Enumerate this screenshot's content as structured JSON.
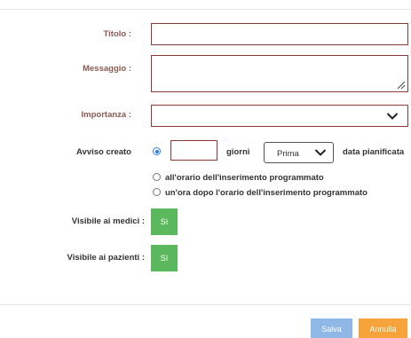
{
  "form": {
    "title_label": "Titolo :",
    "title_value": "",
    "message_label": "Messaggio :",
    "message_value": "",
    "importance_label": "Importanza :",
    "importance_value": "",
    "notice_label": "Avviso creato",
    "days_value": "",
    "days_unit": "giorni",
    "when_select": "Prima",
    "planned_date_label": "data pianificata",
    "option_at_time": "all'orario dell'inserimento programmato",
    "option_hour_after": "un'ora dopo l'orario dell'inserimento programmato",
    "selected_option": "days_before",
    "visible_doctors_label": "Visibile ai medici :",
    "visible_doctors_value": "Sì",
    "visible_patients_label": "Visibile ai pazienti :",
    "visible_patients_value": "Sì"
  },
  "footer": {
    "save_label": "Salva",
    "cancel_label": "Annulla"
  },
  "colors": {
    "field_border": "#8b3a3a",
    "label_color": "#8a5a52",
    "toggle_green": "#5cb85c",
    "save_blue": "#8fb8e6",
    "cancel_orange": "#f5a33a",
    "radio_blue": "#2e7df0"
  }
}
